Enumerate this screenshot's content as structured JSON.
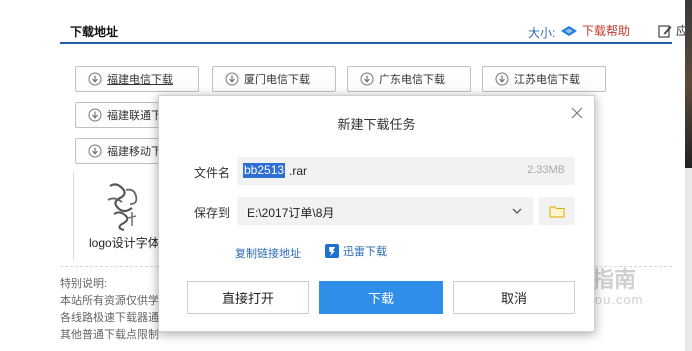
{
  "page": {
    "section_title": "下载地址",
    "size_label": "大小:",
    "help_link": "下载帮助",
    "apps_link": "应用软件",
    "download_buttons": [
      {
        "label": "福建电信下载"
      },
      {
        "label": "厦门电信下载"
      },
      {
        "label": "广东电信下载"
      },
      {
        "label": "江苏电信下载"
      },
      {
        "label": "福建联通下载"
      },
      {
        "label": "福建移动下载"
      }
    ],
    "logo_caption": "logo设计字体",
    "notes": [
      "特别说明:",
      "本站所有资源仅供学习",
      "各线路极速下载器通",
      "其他普通下载点限制"
    ]
  },
  "watermark": {
    "text": "搜狗指南",
    "domain": "zhinan.sogou.com"
  },
  "dialog": {
    "title": "新建下载任务",
    "filename_label": "文件名",
    "filename_selected": "bb2513",
    "filename_ext": ".rar",
    "file_size": "2.33MB",
    "saveto_label": "保存到",
    "save_path": "E:\\2017订单\\8月",
    "copy_link": "复制链接地址",
    "thunder_link": "迅雷下载",
    "open_button": "直接打开",
    "download_button": "下载",
    "cancel_button": "取消"
  },
  "colors": {
    "accent_blue": "#2f8fe8",
    "selection_blue": "#2f6fd4",
    "link_blue": "#2b6bb3",
    "help_red": "#c0392b"
  },
  "icons": {
    "close": "close-icon",
    "chevron": "chevron-down-icon",
    "folder": "folder-icon",
    "thunder": "thunder-icon",
    "download_arrow": "download-arrow-icon"
  }
}
